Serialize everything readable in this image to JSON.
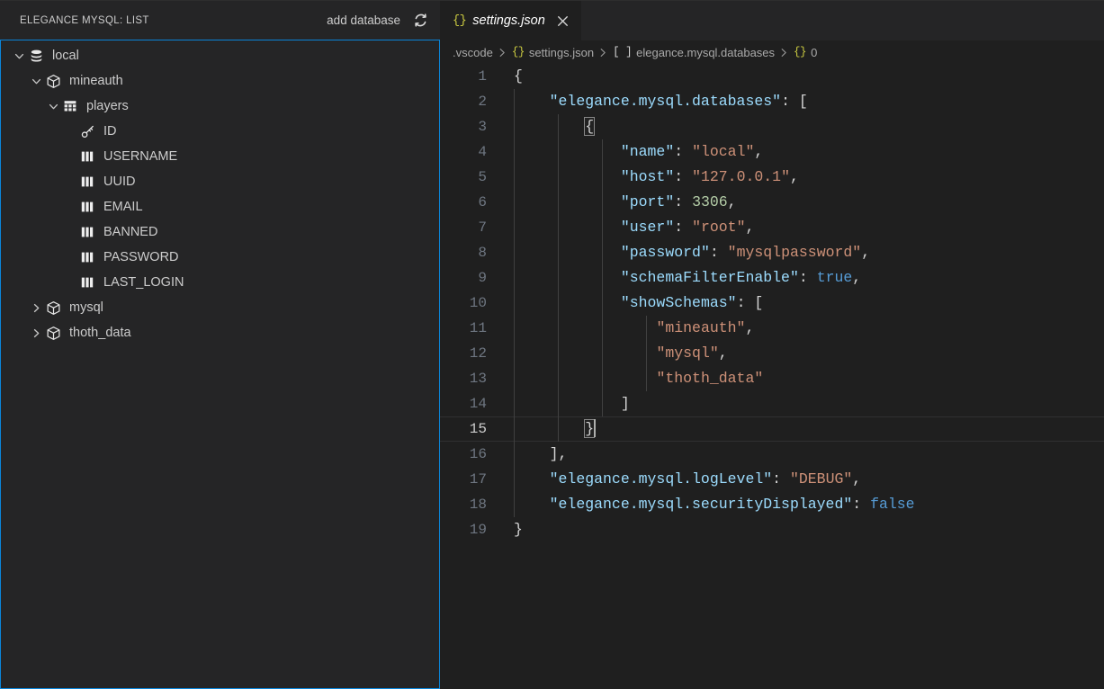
{
  "sidebar": {
    "panel_title": "ELEGANCE MYSQL: LIST",
    "add_database_label": "add database",
    "refresh_icon": "refresh-icon",
    "tree": [
      {
        "label": "local",
        "icon": "database-icon",
        "indent": 0,
        "twisty": "chevron-down"
      },
      {
        "label": "mineauth",
        "icon": "schema-cube-icon",
        "indent": 1,
        "twisty": "chevron-down"
      },
      {
        "label": "players",
        "icon": "table-icon",
        "indent": 2,
        "twisty": "chevron-down"
      },
      {
        "label": "ID",
        "icon": "primary-key-icon",
        "indent": 3,
        "twisty": "none"
      },
      {
        "label": "USERNAME",
        "icon": "column-icon",
        "indent": 3,
        "twisty": "none"
      },
      {
        "label": "UUID",
        "icon": "column-icon",
        "indent": 3,
        "twisty": "none"
      },
      {
        "label": "EMAIL",
        "icon": "column-icon",
        "indent": 3,
        "twisty": "none"
      },
      {
        "label": "BANNED",
        "icon": "column-icon",
        "indent": 3,
        "twisty": "none"
      },
      {
        "label": "PASSWORD",
        "icon": "column-icon",
        "indent": 3,
        "twisty": "none"
      },
      {
        "label": "LAST_LOGIN",
        "icon": "column-icon",
        "indent": 3,
        "twisty": "none"
      },
      {
        "label": "mysql",
        "icon": "schema-cube-icon",
        "indent": 1,
        "twisty": "chevron-right"
      },
      {
        "label": "thoth_data",
        "icon": "schema-cube-icon",
        "indent": 1,
        "twisty": "chevron-right"
      }
    ]
  },
  "editor": {
    "tab": {
      "icon": "{}",
      "label": "settings.json",
      "close_icon": "close-icon",
      "dirty": false
    },
    "breadcrumbs": [
      {
        "icon": "",
        "label": ".vscode"
      },
      {
        "icon": "{}",
        "label": "settings.json"
      },
      {
        "icon": "[ ]",
        "label": "elegance.mysql.databases"
      },
      {
        "icon": "{}",
        "label": "0"
      }
    ],
    "active_line": 15,
    "total_lines": 19,
    "lines": [
      {
        "num": "1",
        "indent": 0,
        "guides": 0,
        "tokens": [
          {
            "t": "{",
            "c": "p"
          }
        ]
      },
      {
        "num": "2",
        "indent": 1,
        "guides": 1,
        "tokens": [
          {
            "t": "\"elegance.mysql.databases\"",
            "c": "k"
          },
          {
            "t": ": ",
            "c": "p"
          },
          {
            "t": "[",
            "c": "p"
          }
        ]
      },
      {
        "num": "3",
        "indent": 2,
        "guides": 2,
        "tokens": [
          {
            "t": "{",
            "c": "p match"
          }
        ]
      },
      {
        "num": "4",
        "indent": 3,
        "guides": 3,
        "tokens": [
          {
            "t": "\"name\"",
            "c": "k"
          },
          {
            "t": ": ",
            "c": "p"
          },
          {
            "t": "\"local\"",
            "c": "s"
          },
          {
            "t": ",",
            "c": "p"
          }
        ]
      },
      {
        "num": "5",
        "indent": 3,
        "guides": 3,
        "tokens": [
          {
            "t": "\"host\"",
            "c": "k"
          },
          {
            "t": ": ",
            "c": "p"
          },
          {
            "t": "\"127.0.0.1\"",
            "c": "s"
          },
          {
            "t": ",",
            "c": "p"
          }
        ]
      },
      {
        "num": "6",
        "indent": 3,
        "guides": 3,
        "tokens": [
          {
            "t": "\"port\"",
            "c": "k"
          },
          {
            "t": ": ",
            "c": "p"
          },
          {
            "t": "3306",
            "c": "n"
          },
          {
            "t": ",",
            "c": "p"
          }
        ]
      },
      {
        "num": "7",
        "indent": 3,
        "guides": 3,
        "tokens": [
          {
            "t": "\"user\"",
            "c": "k"
          },
          {
            "t": ": ",
            "c": "p"
          },
          {
            "t": "\"root\"",
            "c": "s"
          },
          {
            "t": ",",
            "c": "p"
          }
        ]
      },
      {
        "num": "8",
        "indent": 3,
        "guides": 3,
        "tokens": [
          {
            "t": "\"password\"",
            "c": "k"
          },
          {
            "t": ": ",
            "c": "p"
          },
          {
            "t": "\"mysqlpassword\"",
            "c": "s"
          },
          {
            "t": ",",
            "c": "p"
          }
        ]
      },
      {
        "num": "9",
        "indent": 3,
        "guides": 3,
        "tokens": [
          {
            "t": "\"schemaFilterEnable\"",
            "c": "k"
          },
          {
            "t": ": ",
            "c": "p"
          },
          {
            "t": "true",
            "c": "b"
          },
          {
            "t": ",",
            "c": "p"
          }
        ]
      },
      {
        "num": "10",
        "indent": 3,
        "guides": 3,
        "tokens": [
          {
            "t": "\"showSchemas\"",
            "c": "k"
          },
          {
            "t": ": ",
            "c": "p"
          },
          {
            "t": "[",
            "c": "p"
          }
        ]
      },
      {
        "num": "11",
        "indent": 4,
        "guides": 4,
        "tokens": [
          {
            "t": "\"mineauth\"",
            "c": "s"
          },
          {
            "t": ",",
            "c": "p"
          }
        ]
      },
      {
        "num": "12",
        "indent": 4,
        "guides": 4,
        "tokens": [
          {
            "t": "\"mysql\"",
            "c": "s"
          },
          {
            "t": ",",
            "c": "p"
          }
        ]
      },
      {
        "num": "13",
        "indent": 4,
        "guides": 4,
        "tokens": [
          {
            "t": "\"thoth_data\"",
            "c": "s"
          }
        ]
      },
      {
        "num": "14",
        "indent": 3,
        "guides": 3,
        "tokens": [
          {
            "t": "]",
            "c": "p"
          }
        ]
      },
      {
        "num": "15",
        "indent": 2,
        "guides": 2,
        "tokens": [
          {
            "t": "}",
            "c": "p match"
          }
        ],
        "cursor": true,
        "active": true
      },
      {
        "num": "16",
        "indent": 1,
        "guides": 1,
        "tokens": [
          {
            "t": "]",
            "c": "p"
          },
          {
            "t": ",",
            "c": "p"
          }
        ]
      },
      {
        "num": "17",
        "indent": 1,
        "guides": 1,
        "tokens": [
          {
            "t": "\"elegance.mysql.logLevel\"",
            "c": "k"
          },
          {
            "t": ": ",
            "c": "p"
          },
          {
            "t": "\"DEBUG\"",
            "c": "s"
          },
          {
            "t": ",",
            "c": "p"
          }
        ]
      },
      {
        "num": "18",
        "indent": 1,
        "guides": 1,
        "tokens": [
          {
            "t": "\"elegance.mysql.securityDisplayed\"",
            "c": "k"
          },
          {
            "t": ": ",
            "c": "p"
          },
          {
            "t": "false",
            "c": "b"
          }
        ]
      },
      {
        "num": "19",
        "indent": 0,
        "guides": 0,
        "tokens": [
          {
            "t": "}",
            "c": "p"
          }
        ]
      }
    ]
  },
  "colors": {
    "sidebar_bg": "#252526",
    "editor_bg": "#1f1f1f",
    "focus_border": "#0a84d8",
    "key": "#9cdcfe",
    "string": "#ce9178",
    "number": "#b5cea8",
    "boolean": "#569cd6",
    "json_icon": "#cbcb41",
    "line_number": "#6e7681",
    "foreground": "#cccccc"
  }
}
